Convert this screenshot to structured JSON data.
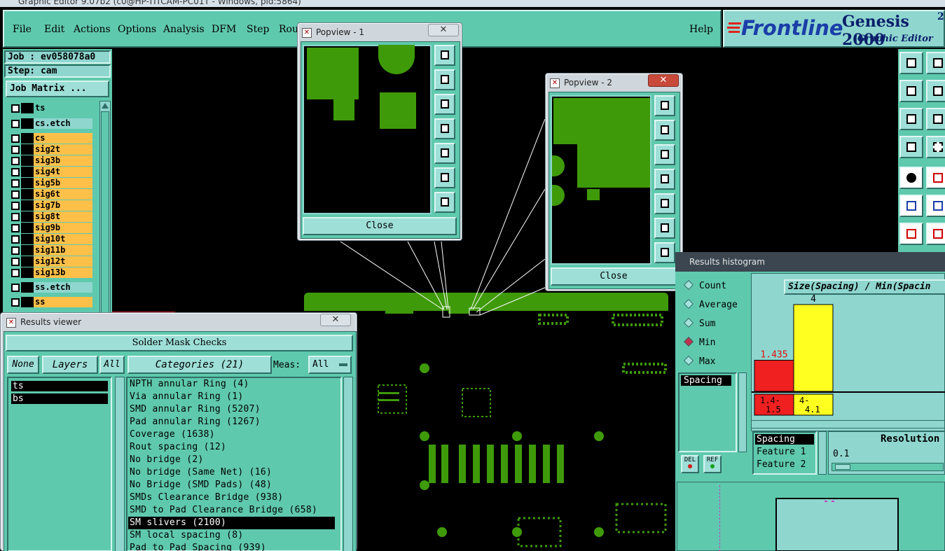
{
  "titlebar": {
    "text": "Graphic Editor 9.07b2 (c0@HP-TITCAM-PC01T - Windows, pid:5864)"
  },
  "menu": {
    "items": [
      "File",
      "Edit",
      "Actions",
      "Options",
      "Analysis",
      "DFM",
      "Step",
      "Rou"
    ],
    "help": "Help"
  },
  "brand": {
    "logo": "Frontline",
    "product": "Genesis 2000",
    "sup": "2",
    "subtitle": "Graphic Editor"
  },
  "job": {
    "job_label": "Job : ev058078a0",
    "step_label": "Step: cam",
    "matrix_button": "Job Matrix ..."
  },
  "layers": [
    {
      "name": "ts",
      "color": "#5fc9ad"
    },
    {
      "name": "cs.etch",
      "color": "#8fd6cf"
    },
    {
      "name": "cs",
      "color": "#ffc04a"
    },
    {
      "name": "sig2t",
      "color": "#ffc04a"
    },
    {
      "name": "sig3b",
      "color": "#ffc04a"
    },
    {
      "name": "sig4t",
      "color": "#ffc04a"
    },
    {
      "name": "sig5b",
      "color": "#ffc04a"
    },
    {
      "name": "sig6t",
      "color": "#ffc04a"
    },
    {
      "name": "sig7b",
      "color": "#ffc04a"
    },
    {
      "name": "sig8t",
      "color": "#ffc04a"
    },
    {
      "name": "sig9b",
      "color": "#ffc04a"
    },
    {
      "name": "sig10t",
      "color": "#ffc04a"
    },
    {
      "name": "sig11b",
      "color": "#ffc04a"
    },
    {
      "name": "sig12t",
      "color": "#ffc04a"
    },
    {
      "name": "sig13b",
      "color": "#ffc04a"
    },
    {
      "name": "ss.etch",
      "color": "#8fd6cf"
    },
    {
      "name": "ss",
      "color": "#ffc04a"
    }
  ],
  "popview1": {
    "title": "Popview - 1",
    "close": "Close"
  },
  "popview2": {
    "title": "Popview - 2",
    "close": "Close"
  },
  "results_viewer": {
    "title": "Results viewer",
    "header": "Solder Mask Checks",
    "none_btn": "None",
    "layers_btn": "Layers",
    "all_btn": "All",
    "categories_btn": "Categories (21)",
    "meas_label": "Meas:",
    "meas_value": "All",
    "layer_list": [
      "ts",
      "bs"
    ],
    "categories": [
      "NPTH annular Ring (4)",
      "Via annular Ring (1)",
      "SMD annular Ring (5207)",
      "Pad annular Ring (1267)",
      "Coverage (1638)",
      "Rout spacing (12)",
      "No bridge (2)",
      "No bridge (Same Net) (16)",
      "No Bridge (SMD Pads) (48)",
      "SMDs Clearance Bridge (938)",
      "SMD to Pad Clearance Bridge (658)",
      "SM slivers (2100)",
      "SM local spacing (8)",
      "Pad to Pad Spacing (939)"
    ],
    "selected_category": "SM slivers (2100)"
  },
  "histogram": {
    "title": "Results histogram",
    "modes": [
      "Count",
      "Average",
      "Sum",
      "Min",
      "Max"
    ],
    "selected_mode": "Min",
    "list_item": "Spacing",
    "del_btn": "DEL",
    "ref_btn": "REF",
    "chart_title": "Size(Spacing) / Min(Spacin",
    "features": [
      "Spacing",
      "Feature 1",
      "Feature 2"
    ],
    "resolution_label": "Resolution",
    "resolution_value": "0.1",
    "chart_data": {
      "type": "bar",
      "categories": [
        "1.4-\n1.5",
        "4-\n4.1"
      ],
      "category_labels": [
        "1.4-",
        "1.5",
        "4-",
        "4.1"
      ],
      "values": [
        1.435,
        4
      ],
      "value_labels": [
        "1.435",
        "4"
      ],
      "colors": [
        "#f02020",
        "#ffff20"
      ],
      "title": "Size(Spacing) / Min(Spacin"
    }
  }
}
